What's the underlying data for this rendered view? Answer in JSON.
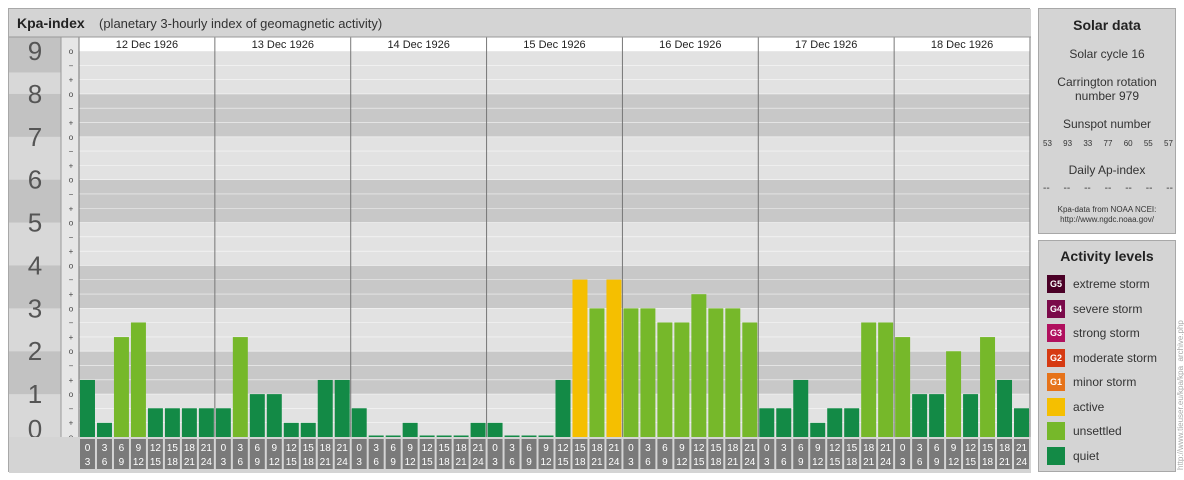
{
  "header": {
    "title": "Kpa-index",
    "subtitle": "(planetary 3-hourly index of geomagnetic activity)"
  },
  "chart_data": {
    "type": "bar",
    "days": [
      "12 Dec 1926",
      "13 Dec 1926",
      "14 Dec 1926",
      "15 Dec 1926",
      "16 Dec 1926",
      "17 Dec 1926",
      "18 Dec 1926"
    ],
    "interval_starts": [
      "0",
      "3",
      "6",
      "9",
      "12",
      "15",
      "18",
      "21"
    ],
    "interval_ends": [
      "3",
      "6",
      "9",
      "12",
      "15",
      "18",
      "21",
      "24"
    ],
    "ylim": [
      0,
      9
    ],
    "y_major_ticks": [
      "0",
      "1",
      "2",
      "3",
      "4",
      "5",
      "6",
      "7",
      "8",
      "9"
    ],
    "y_minor_ticks": [
      "o",
      "+",
      "−"
    ],
    "values": [
      [
        1.33,
        0.33,
        2.33,
        2.67,
        0.67,
        0.67,
        0.67,
        0.67
      ],
      [
        0.67,
        2.33,
        1,
        1,
        0.33,
        0.33,
        1.33,
        1.33
      ],
      [
        0.67,
        0,
        0,
        0.33,
        0,
        0,
        0,
        0.33
      ],
      [
        0.33,
        0,
        0,
        0,
        1.33,
        3.67,
        3,
        3.67
      ],
      [
        3,
        3,
        2.67,
        2.67,
        3.33,
        3,
        3,
        2.67
      ],
      [
        0.67,
        0.67,
        1.33,
        0.33,
        0.67,
        0.67,
        2.67,
        2.67
      ],
      [
        2.33,
        1,
        1,
        2,
        1,
        2.33,
        1.33,
        0.67
      ]
    ],
    "colors": {
      "quiet": "#138a46",
      "unsettled": "#76b82a",
      "active": "#f5bf00"
    }
  },
  "solar": {
    "title": "Solar data",
    "cycle": "Solar cycle 16",
    "carrington_line1": "Carrington rotation",
    "carrington_line2": "number 979",
    "sunspot_label": "Sunspot number",
    "sunspot_values": [
      "53",
      "93",
      "33",
      "77",
      "60",
      "55",
      "57"
    ],
    "ap_label": "Daily Ap-index",
    "ap_values": [
      "--",
      "--",
      "--",
      "--",
      "--",
      "--",
      "--"
    ],
    "credit_line1": "Kpa-data from NOAA NCEI:",
    "credit_line2": "http://www.ngdc.noaa.gov/"
  },
  "activity": {
    "title": "Activity levels",
    "levels": [
      {
        "code": "G5",
        "label": "extreme storm",
        "color": "#4a0026"
      },
      {
        "code": "G4",
        "label": "severe storm",
        "color": "#7a0a4a"
      },
      {
        "code": "G3",
        "label": "strong storm",
        "color": "#b0105e"
      },
      {
        "code": "G2",
        "label": "moderate storm",
        "color": "#d63a12"
      },
      {
        "code": "G1",
        "label": "minor storm",
        "color": "#e6731a"
      },
      {
        "code": "",
        "label": "active",
        "color": "#f5bf00"
      },
      {
        "code": "",
        "label": "unsettled",
        "color": "#76b82a"
      },
      {
        "code": "",
        "label": "quiet",
        "color": "#138a46"
      }
    ]
  },
  "watermark": "http://www.tieuser.eu/kpa/kpa_archive.php"
}
